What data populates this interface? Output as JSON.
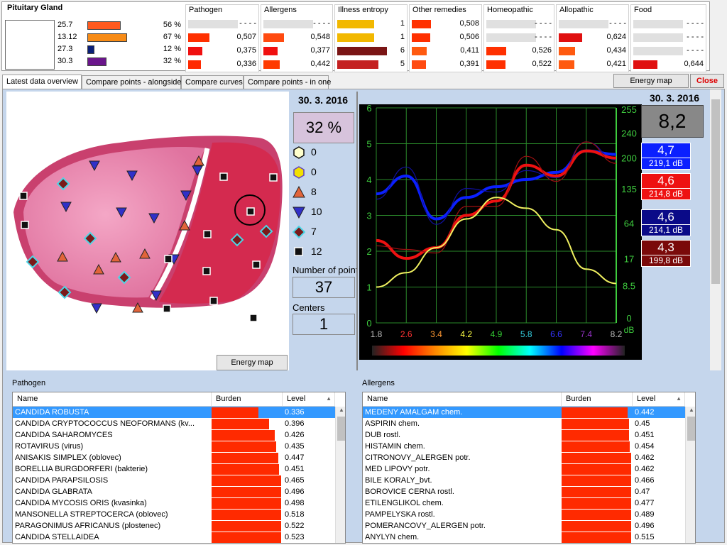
{
  "organ": {
    "title": "Pituitary Gland",
    "rows": [
      {
        "value": "25.7",
        "pct": "56 %",
        "color": "#ff5a1f"
      },
      {
        "value": "13.12",
        "pct": "67 %",
        "color": "#f78b16"
      },
      {
        "value": "27.3",
        "pct": "12 %",
        "color": "#0a1f77"
      },
      {
        "value": "30.3",
        "pct": "32 %",
        "color": "#6a158b"
      }
    ]
  },
  "categories": [
    {
      "title": "Pathogen",
      "rows": [
        {
          "v": "- - - -",
          "c": "#e0e0e0"
        },
        {
          "v": "0,507",
          "c": "#ff3000"
        },
        {
          "v": "0,375",
          "c": "#f01010"
        },
        {
          "v": "0,336",
          "c": "#ff2a00"
        }
      ]
    },
    {
      "title": "Allergens",
      "rows": [
        {
          "v": "- - - -",
          "c": "#e0e0e0"
        },
        {
          "v": "0,548",
          "c": "#ff4a10"
        },
        {
          "v": "0,377",
          "c": "#f01010"
        },
        {
          "v": "0,442",
          "c": "#ff3a00"
        }
      ]
    },
    {
      "title": "Illness entropy",
      "rows": [
        {
          "v": "1",
          "c": "#f2b800"
        },
        {
          "v": "1",
          "c": "#f2b800"
        },
        {
          "v": "6",
          "c": "#7a1515"
        },
        {
          "v": "5",
          "c": "#c42020"
        }
      ]
    },
    {
      "title": "Other remedies",
      "rows": [
        {
          "v": "0,508",
          "c": "#ff3000"
        },
        {
          "v": "0,506",
          "c": "#ff3000"
        },
        {
          "v": "0,411",
          "c": "#ff5a10"
        },
        {
          "v": "0,391",
          "c": "#ff4a10"
        }
      ]
    },
    {
      "title": "Homeopathic",
      "rows": [
        {
          "v": "- - - -",
          "c": "#e0e0e0"
        },
        {
          "v": "- - - -",
          "c": "#e0e0e0"
        },
        {
          "v": "0,526",
          "c": "#ff3000"
        },
        {
          "v": "0,522",
          "c": "#ff3000"
        }
      ]
    },
    {
      "title": "Allopathic",
      "rows": [
        {
          "v": "- - - -",
          "c": "#e0e0e0"
        },
        {
          "v": "0,624",
          "c": "#e01010"
        },
        {
          "v": "0,434",
          "c": "#ff5a10"
        },
        {
          "v": "0,421",
          "c": "#ff5a10"
        }
      ]
    },
    {
      "title": "Food",
      "rows": [
        {
          "v": "- - - -",
          "c": "#e0e0e0"
        },
        {
          "v": "- - - -",
          "c": "#e0e0e0"
        },
        {
          "v": "- - - -",
          "c": "#e0e0e0"
        },
        {
          "v": "0,644",
          "c": "#e01010"
        }
      ]
    }
  ],
  "tabs": [
    "Latest data overview",
    "Compare points - alongside",
    "Compare curves",
    "Compare points - in one"
  ],
  "buttons": {
    "energy_map_top": "Energy map",
    "close": "Close",
    "energy_map": "Energy map"
  },
  "points": {
    "date": "30. 3. 2016",
    "percent": "32 %",
    "legend": [
      {
        "shape": "hexagon-light",
        "count": "0"
      },
      {
        "shape": "hexagon-yellow",
        "count": "0"
      },
      {
        "shape": "triangle-up",
        "count": "8"
      },
      {
        "shape": "triangle-down",
        "count": "10"
      },
      {
        "shape": "diamond",
        "count": "7"
      },
      {
        "shape": "square",
        "count": "12"
      }
    ],
    "num_label": "Number of points",
    "num_value": "37",
    "centers_label": "Centers",
    "centers_value": "1"
  },
  "chart_panel": {
    "date": "30. 3. 2016",
    "big_value": "8,2",
    "values": [
      {
        "a": "4,7",
        "d": "219,1 dB",
        "color": "#0b20ff"
      },
      {
        "a": "4,6",
        "d": "214,8 dB",
        "color": "#ee1111"
      },
      {
        "a": "4,6",
        "d": "214,1 dB",
        "color": "#0a0a88"
      },
      {
        "a": "4,3",
        "d": "199,8 dB",
        "color": "#7a0a0a"
      }
    ]
  },
  "chart_data": {
    "type": "line",
    "x": [
      1.8,
      2.6,
      3.4,
      4.2,
      4.9,
      5.8,
      6.6,
      7.4,
      8.2
    ],
    "x_tick_labels": [
      "1.8",
      "2.6",
      "3.4",
      "4.2",
      "4.9",
      "5.8",
      "6.6",
      "7.4",
      "8.2"
    ],
    "x_tick_colors": [
      "#bbbbbb",
      "#ff3333",
      "#ff9933",
      "#ffff44",
      "#33cc33",
      "#33ccdd",
      "#3333ff",
      "#9933cc",
      "#bbbbbb"
    ],
    "ylim": [
      0,
      6
    ],
    "y_left_ticks": [
      "0",
      "1",
      "2",
      "3",
      "4",
      "5",
      "6"
    ],
    "y_right_ticks": [
      "0",
      "8.5",
      "17",
      "64",
      "135",
      "200",
      "240",
      "255"
    ],
    "y_right_unit": "dB",
    "grid": true,
    "series": [
      {
        "color": "#0b20ff",
        "values": [
          3.6,
          4.1,
          2.9,
          3.5,
          3.8,
          4.0,
          4.2,
          4.8,
          4.7
        ]
      },
      {
        "color": "#ee1111",
        "values": [
          2.3,
          1.8,
          2.1,
          3.0,
          3.4,
          4.4,
          4.1,
          4.8,
          4.6
        ]
      },
      {
        "color": "#f0f060",
        "values": [
          1.0,
          1.4,
          2.1,
          2.9,
          3.5,
          3.2,
          2.6,
          1.5,
          1.1
        ]
      }
    ]
  },
  "pathogen_table": {
    "title": "Pathogen",
    "columns": [
      "Name",
      "Burden",
      "Level"
    ],
    "rows": [
      {
        "name": "CANDIDA ROBUSTA",
        "level": "0.336",
        "burden": 0.336
      },
      {
        "name": "CANDIDA CRYPTOCOCCUS NEOFORMANS (kv...",
        "level": "0.396",
        "burden": 0.396
      },
      {
        "name": "CANDIDA SAHAROMYCES",
        "level": "0.426",
        "burden": 0.426
      },
      {
        "name": "ROTAVIRUS (virus)",
        "level": "0.435",
        "burden": 0.435
      },
      {
        "name": "ANISAKIS SIMPLEX (oblovec)",
        "level": "0.447",
        "burden": 0.447
      },
      {
        "name": "BORELLIA BURGDORFERI (bakterie)",
        "level": "0.451",
        "burden": 0.451
      },
      {
        "name": "CANDIDA PARAPSILOSIS",
        "level": "0.465",
        "burden": 0.465
      },
      {
        "name": "CANDIDA GLABRATA",
        "level": "0.496",
        "burden": 0.496
      },
      {
        "name": "CANDIDA MYCOSIS ORIS (kvasinka)",
        "level": "0.498",
        "burden": 0.498
      },
      {
        "name": "MANSONELLA STREPTOCERCA (oblovec)",
        "level": "0.518",
        "burden": 0.518
      },
      {
        "name": "PARAGONIMUS AFRICANUS (plostenec)",
        "level": "0.522",
        "burden": 0.522
      },
      {
        "name": "CANDIDA STELLAIDEA",
        "level": "0.523",
        "burden": 0.523
      }
    ]
  },
  "allergens_table": {
    "title": "Allergens",
    "columns": [
      "Name",
      "Burden",
      "Level"
    ],
    "rows": [
      {
        "name": "MEDENY AMALGAM chem.",
        "level": "0.442",
        "burden": 0.442
      },
      {
        "name": "ASPIRIN chem.",
        "level": "0.45",
        "burden": 0.45
      },
      {
        "name": "DUB rostl.",
        "level": "0.451",
        "burden": 0.451
      },
      {
        "name": "HISTAMIN chem.",
        "level": "0.454",
        "burden": 0.454
      },
      {
        "name": "CITRONOVY_ALERGEN potr.",
        "level": "0.462",
        "burden": 0.462
      },
      {
        "name": "MED LIPOVY potr.",
        "level": "0.462",
        "burden": 0.462
      },
      {
        "name": "BILE KORALY_bvt.",
        "level": "0.466",
        "burden": 0.466
      },
      {
        "name": "BOROVICE CERNA rostl.",
        "level": "0.47",
        "burden": 0.47
      },
      {
        "name": "ETILENGLIKOL chem.",
        "level": "0.477",
        "burden": 0.477
      },
      {
        "name": "PAMPELYSKA rostl.",
        "level": "0.489",
        "burden": 0.489
      },
      {
        "name": "POMERANCOVY_ALERGEN potr.",
        "level": "0.496",
        "burden": 0.496
      },
      {
        "name": "ANYLYN chem.",
        "level": "0.515",
        "burden": 0.515
      }
    ]
  }
}
